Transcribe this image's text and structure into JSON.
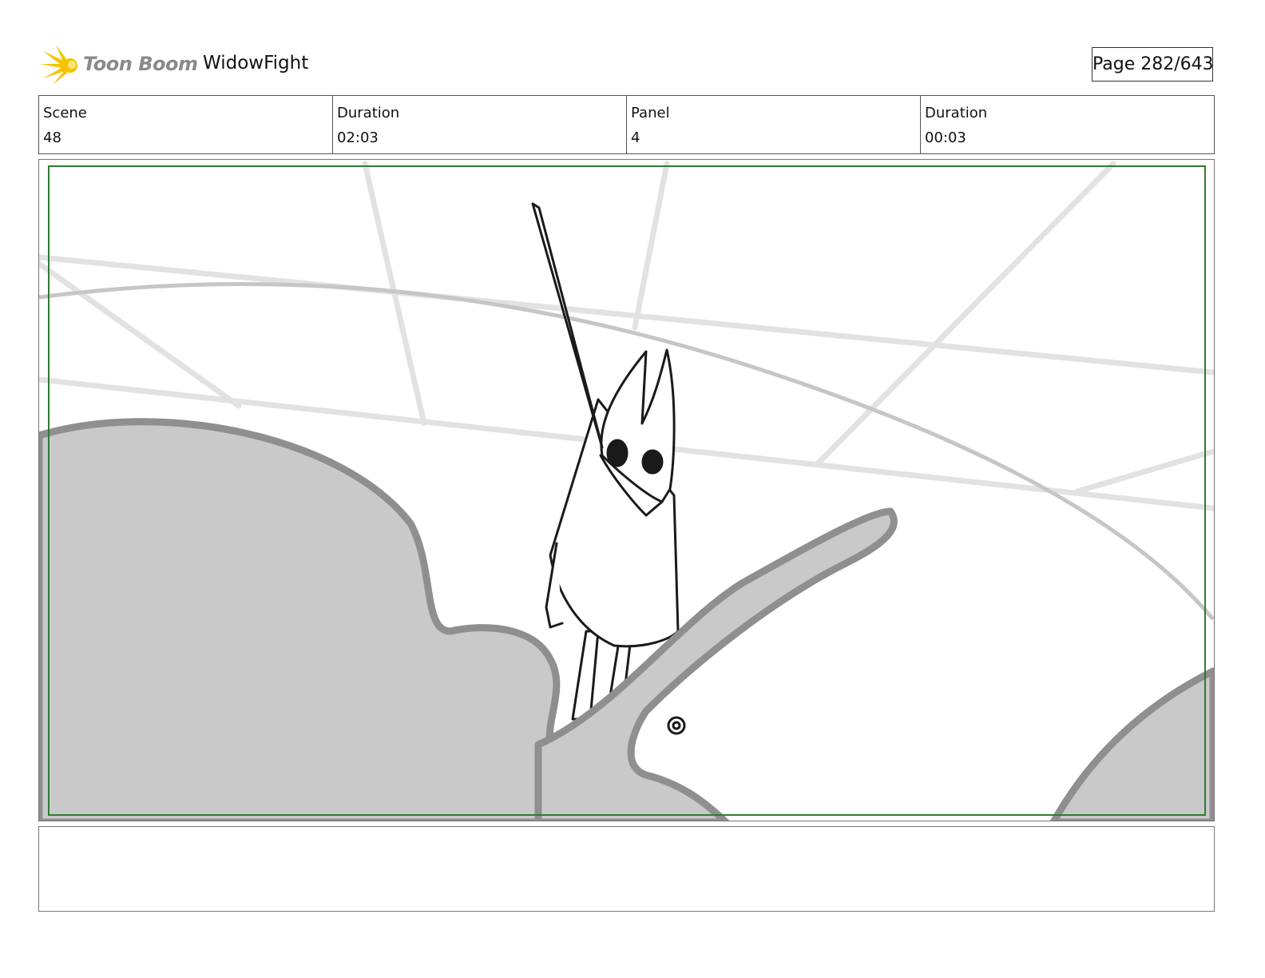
{
  "header": {
    "logo_text": "Toon Boom",
    "project_title": "WidowFight",
    "page_label": "Page 282/643"
  },
  "info": {
    "scene_label": "Scene",
    "scene_value": "48",
    "scene_duration_label": "Duration",
    "scene_duration_value": "02:03",
    "panel_label": "Panel",
    "panel_value": "4",
    "panel_duration_label": "Duration",
    "panel_duration_value": "00:03"
  },
  "panel": {
    "notes": "",
    "safe_frame_color": "#2e7d32"
  },
  "colors": {
    "logo_burst": "#f5c400",
    "logo_text": "#8a8a8a",
    "ground_fill": "#c9c9c9",
    "ground_outline": "#8f8f8f",
    "background_lines": "#e2e2e2"
  }
}
